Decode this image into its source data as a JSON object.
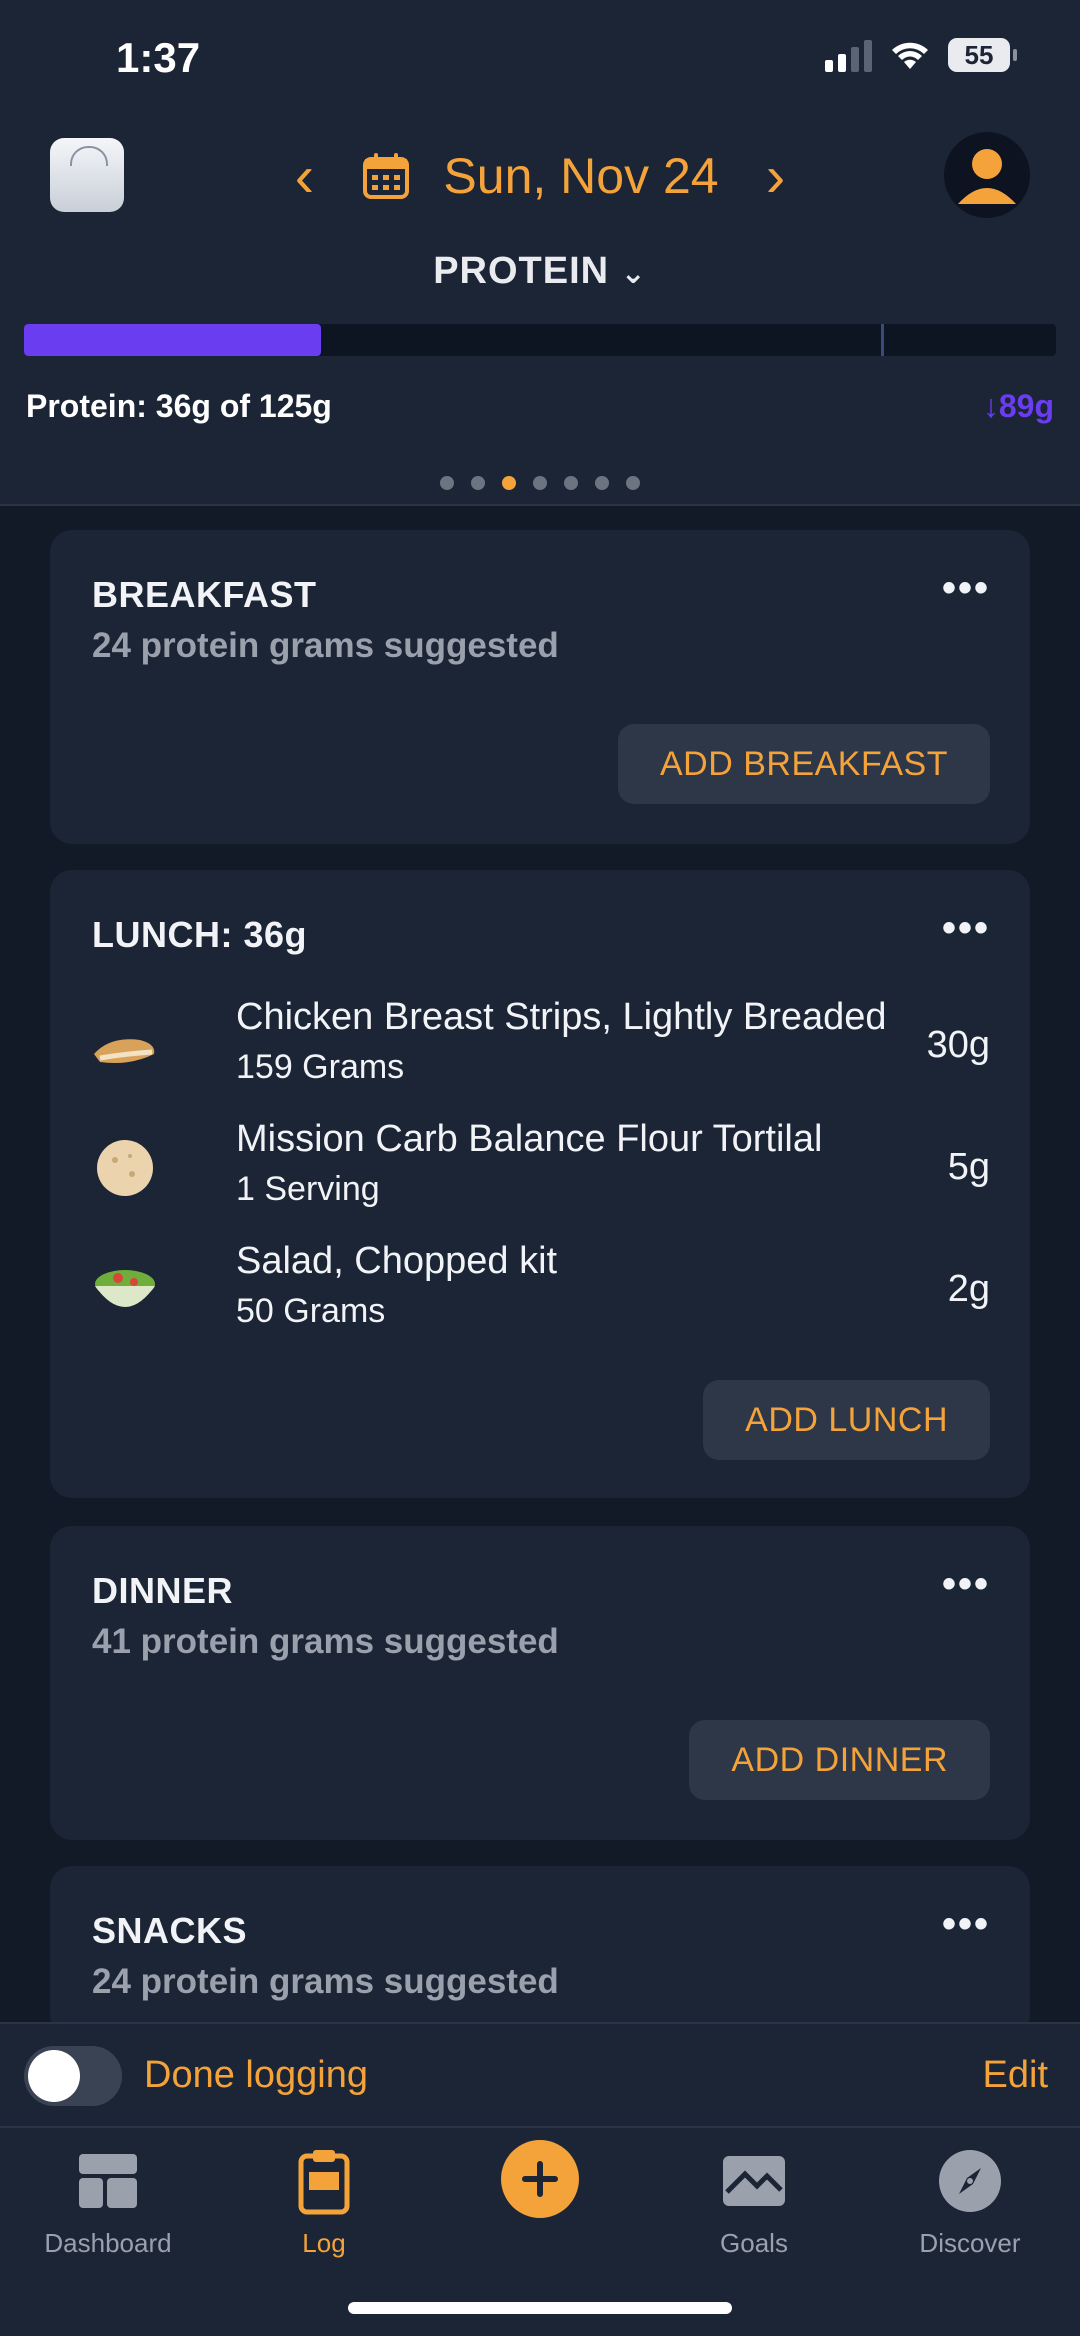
{
  "status_bar": {
    "time": "1:37",
    "battery": "55"
  },
  "header": {
    "date": "Sun, Nov 24",
    "metric": "PROTEIN",
    "progress_fraction": 0.288,
    "goal_marker_fraction": 0.83,
    "progress_text": "Protein: 36g of 125g",
    "remaining_text": "↓89g",
    "page_dots": 7,
    "active_dot": 2
  },
  "meals": {
    "breakfast": {
      "title": "BREAKFAST",
      "subtitle": "24 protein grams suggested",
      "add_label": "ADD BREAKFAST"
    },
    "lunch": {
      "title": "LUNCH: 36g",
      "add_label": "ADD LUNCH",
      "items": [
        {
          "name": "Chicken Breast Strips, Lightly Breaded",
          "qty": "159 Grams",
          "value": "30g",
          "icon": "chicken-strip-icon"
        },
        {
          "name": "Mission Carb Balance Flour Tortilal",
          "qty": "1 Serving",
          "value": "5g",
          "icon": "tortilla-icon"
        },
        {
          "name": "Salad, Chopped kit",
          "qty": "50 Grams",
          "value": "2g",
          "icon": "salad-bowl-icon"
        }
      ]
    },
    "dinner": {
      "title": "DINNER",
      "subtitle": "41 protein grams suggested",
      "add_label": "ADD DINNER"
    },
    "snacks": {
      "title": "SNACKS",
      "subtitle": "24 protein grams suggested"
    }
  },
  "done_bar": {
    "label": "Done logging",
    "edit": "Edit"
  },
  "tabs": [
    {
      "label": "Dashboard",
      "icon": "dashboard-icon"
    },
    {
      "label": "Log",
      "icon": "clipboard-icon"
    },
    {
      "label": "",
      "icon": "plus-icon"
    },
    {
      "label": "Goals",
      "icon": "goals-icon"
    },
    {
      "label": "Discover",
      "icon": "compass-icon"
    }
  ],
  "colors": {
    "accent": "#f4a23a",
    "progress": "#6a3df0",
    "card": "#1c2535",
    "background": "#121a27"
  }
}
